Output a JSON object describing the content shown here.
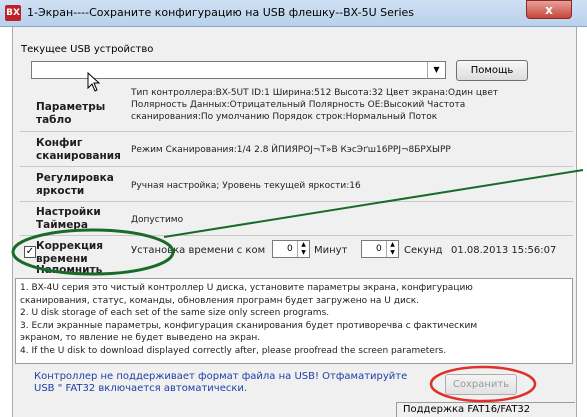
{
  "window": {
    "app_icon_text": "BX",
    "title": "1-Экран----Сохраните конфигурацию на  USB флешку--BX-5U Series",
    "close_symbol": "x"
  },
  "device": {
    "label": "Текущее USB устройство",
    "value": "",
    "dropdown_arrow": "▼",
    "help_button": "Помощь"
  },
  "params": {
    "label": "Параметры табло",
    "line1": "Тип контроллера:BX-5UT  ID:1  Ширина:512  Высота:32  Цвет экрана:Один цвет",
    "line2": "Полярность Данных:Отрицательный  Полярность OE:Высокий  Частота",
    "line3": "сканирования:По умолчанию  Порядок строк:Нормальный  Поток"
  },
  "scan_config": {
    "label": "Конфиг сканирования",
    "value": "Режим Сканирования:1/4    2.8  ЙПИЯРОЈ¬Т»В КэсЭґш16РРЈ¬8БРХЫРР"
  },
  "brightness": {
    "label": "Регулировка яркости",
    "value": "Ручная настройка;  Уровень текущей яркости:16"
  },
  "timer": {
    "label": "Настройки Таймера",
    "value": "Допустимо"
  },
  "time_correction": {
    "checked": true,
    "check_mark": "✓",
    "label": "Коррекция времени",
    "set_text": "Установка времени с ком",
    "minutes_value": "0",
    "minutes_label": "Минут",
    "seconds_value": "0",
    "seconds_label": "Секунд",
    "datetime": "01.08.2013 15:56:07"
  },
  "reminder": {
    "label": "Напомнить",
    "lines": [
      "1.  BX-4U серия это чистый контроллер U диска, установите параметры экрана, конфигурацию",
      "сканирования, статус, команды, обновления програмн будет загружено на U диск.",
      "   2.  U disk storage of each set of the same size only screen programs.",
      "   3.  Если экранные параметры, конфигурация сканирования будет противоречва с фактическим",
      "экраном, то явление не будет выведено на экран.",
      "   4.  If the U disk to download displayed correctly after, please proofread the screen parameters."
    ]
  },
  "warning": {
    "line1": "Контроллер не поддерживает формат файла на USB! Отфаматируйте",
    "line2": "USB \" FAT32 включается автоматически."
  },
  "save_button": "Сохранить",
  "status": "Поддержка  FAT16/FAT32",
  "colors": {
    "annotation_green": "#1a6b2a",
    "annotation_red": "#e0302a",
    "warning_text": "#1d3fa8"
  }
}
